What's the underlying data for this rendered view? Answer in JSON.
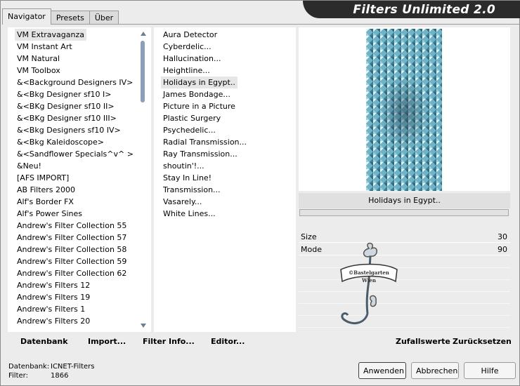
{
  "window": {
    "title": "Filters Unlimited 2.0"
  },
  "tabs": [
    {
      "label": "Navigator"
    },
    {
      "label": "Presets"
    },
    {
      "label": "Über"
    }
  ],
  "categories": {
    "items": [
      "VM Extravaganza",
      "VM Instant Art",
      "VM Natural",
      "VM Toolbox",
      "&<Background Designers IV>",
      "&<Bkg Designer sf10 I>",
      "&<BKg Designer sf10 II>",
      "&<BKg Designer sf10 III>",
      "&<Bkg Designers sf10 IV>",
      "&<Bkg Kaleidoscope>",
      "&<Sandflower Specials^v^ >",
      "&Neu!",
      "[AFS IMPORT]",
      "AB Filters 2000",
      "Alf's Border FX",
      "Alf's Power Sines",
      "Andrew's Filter Collection 55",
      "Andrew's Filter Collection 57",
      "Andrew's Filter Collection 58",
      "Andrew's Filter Collection 59",
      "Andrew's Filter Collection 62",
      "Andrew's Filters 12",
      "Andrew's Filters 19",
      "Andrew's Filters 1",
      "Andrew's Filters 20"
    ],
    "selected": "VM Extravaganza"
  },
  "filters": {
    "items": [
      "Aura Detector",
      "Cyberdelic...",
      "Hallucination...",
      "Heightline...",
      "Holidays in Egypt..",
      "James Bondage...",
      "Picture in a Picture",
      "Plastic Surgery",
      "Psychedelic...",
      "Radial Transmission...",
      "Ray Transmission...",
      "shoutin'!...",
      "Stay In Line!",
      "Transmission...",
      "Vasarely...",
      "White Lines..."
    ],
    "selected": "Holidays in Egypt.."
  },
  "preview": {
    "filter_name": "Holidays in Egypt..",
    "params": [
      {
        "name": "Size",
        "value": "30"
      },
      {
        "name": "Mode",
        "value": "90"
      }
    ],
    "watermark_lines": [
      "©Bastelgarten",
      "Wien"
    ]
  },
  "toolbar": {
    "database": "Datenbank",
    "import": "Import...",
    "filter_info": "Filter Info...",
    "editor": "Editor...",
    "randomize": "Zufallswerte",
    "reset": "Zurücksetzen"
  },
  "status": {
    "database_label": "Datenbank:",
    "database_value": "ICNET-Filters",
    "filter_label": "Filter:",
    "filter_value": "1866"
  },
  "buttons": {
    "ok": "Anwenden",
    "cancel": "Abbrechen",
    "help": "Hilfe"
  },
  "colors": {
    "banner": "#2b2b2b",
    "selection": "#e6e6e6",
    "scroll_thumb": "#8ba0b8",
    "preview_pattern": "#6fb3c6"
  }
}
